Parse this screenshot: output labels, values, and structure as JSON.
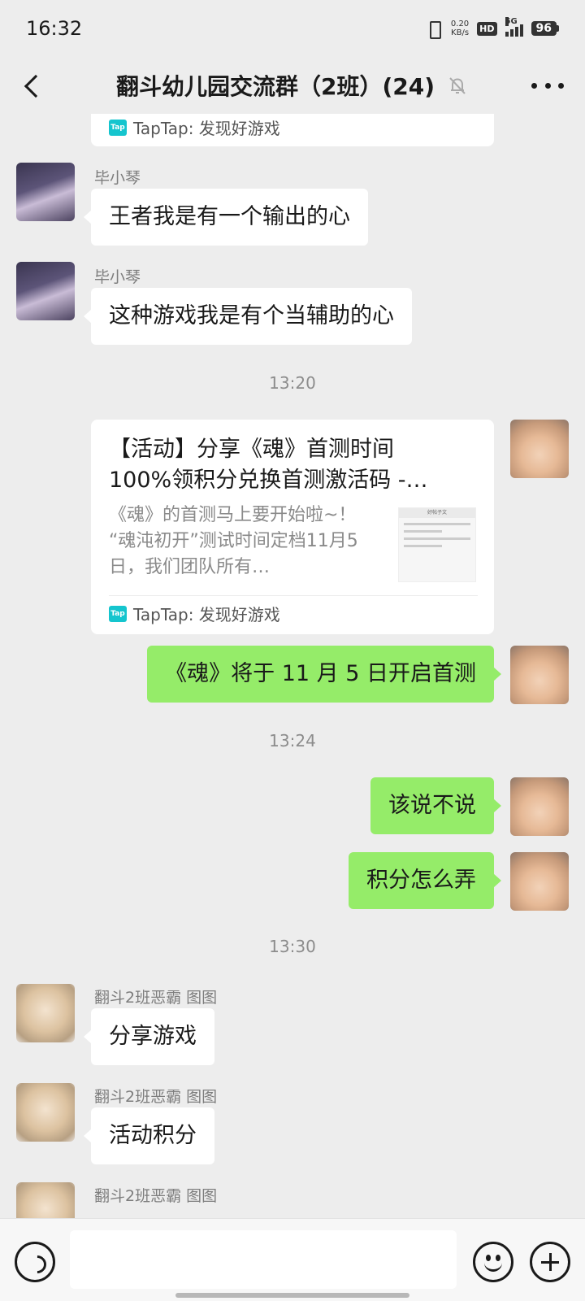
{
  "status": {
    "time": "16:32",
    "net_speed": "0.20",
    "net_unit": "KB/s",
    "hd": "HD",
    "signal": "5G",
    "battery": "96"
  },
  "header": {
    "title": "翻斗幼儿园交流群（2班）(24)"
  },
  "messages": {
    "card_top_source": "TapTap: 发现好游戏",
    "m1_sender": "毕小琴",
    "m1_text": "王者我是有一个输出的心",
    "m2_sender": "毕小琴",
    "m2_text": "这种游戏我是有个当辅助的心",
    "t1": "13:20",
    "card": {
      "title_line1": "【活动】分享《魂》首测时间",
      "title_line2": "100%领积分兑换首测激活码 -…",
      "desc": "《魂》的首测马上要开始啦~！ “魂沌初开”测试时间定档11月5日，我们团队所有…",
      "thumb_heading": "好帖子文",
      "source": "TapTap: 发现好游戏"
    },
    "m3_text": "《魂》将于 11 月 5 日开启首测",
    "t2": "13:24",
    "m4_text": "该说不说",
    "m5_text": "积分怎么弄",
    "t3": "13:30",
    "m6_sender": "翻斗2班恶霸",
    "m6_tag": "图图",
    "m6_text": "分享游戏",
    "m7_sender": "翻斗2班恶霸",
    "m7_tag": "图图",
    "m7_text": "活动积分",
    "m8_sender": "翻斗2班恶霸",
    "m8_tag": "图图"
  },
  "icons": {
    "back": "back-arrow-icon",
    "mute": "bell-off-icon",
    "more": "more-dots-icon",
    "voice": "voice-icon",
    "emoji": "emoji-icon",
    "plus": "plus-icon"
  },
  "colors": {
    "sent_bubble": "#95ec69",
    "recv_bubble": "#ffffff",
    "background": "#ededed",
    "taptap": "#15c5ce"
  }
}
